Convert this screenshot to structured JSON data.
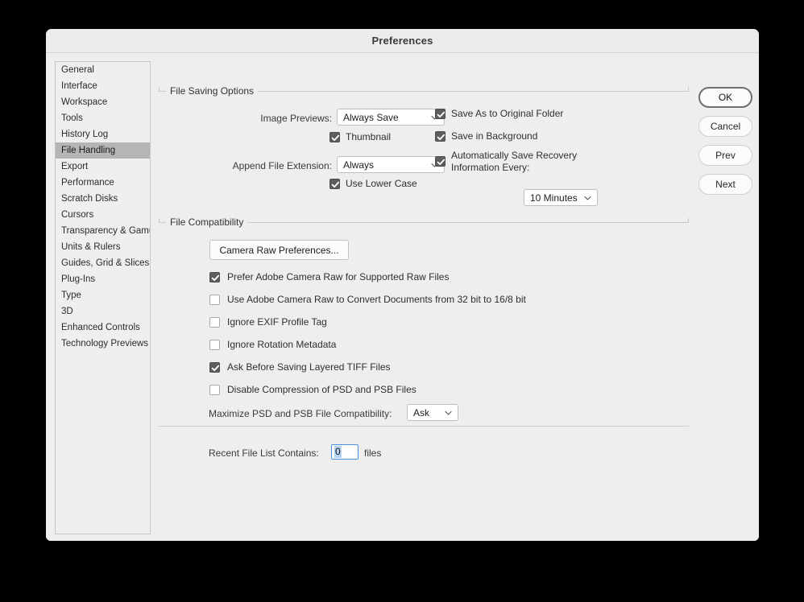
{
  "window": {
    "title": "Preferences"
  },
  "sidebar": {
    "items": [
      {
        "label": "General",
        "selected": false
      },
      {
        "label": "Interface",
        "selected": false
      },
      {
        "label": "Workspace",
        "selected": false
      },
      {
        "label": "Tools",
        "selected": false
      },
      {
        "label": "History Log",
        "selected": false
      },
      {
        "label": "File Handling",
        "selected": true
      },
      {
        "label": "Export",
        "selected": false
      },
      {
        "label": "Performance",
        "selected": false
      },
      {
        "label": "Scratch Disks",
        "selected": false
      },
      {
        "label": "Cursors",
        "selected": false
      },
      {
        "label": "Transparency & Gamut",
        "selected": false
      },
      {
        "label": "Units & Rulers",
        "selected": false
      },
      {
        "label": "Guides, Grid & Slices",
        "selected": false
      },
      {
        "label": "Plug-Ins",
        "selected": false
      },
      {
        "label": "Type",
        "selected": false
      },
      {
        "label": "3D",
        "selected": false
      },
      {
        "label": "Enhanced Controls",
        "selected": false
      },
      {
        "label": "Technology Previews",
        "selected": false
      }
    ]
  },
  "file_saving_options": {
    "legend": "File Saving Options",
    "image_previews_label": "Image Previews:",
    "image_previews_value": "Always Save",
    "thumbnail_label": "Thumbnail",
    "thumbnail_checked": true,
    "append_file_extension_label": "Append File Extension:",
    "append_file_extension_value": "Always",
    "use_lower_case_label": "Use Lower Case",
    "use_lower_case_checked": true,
    "save_as_original_folder_label": "Save As to Original Folder",
    "save_as_original_folder_checked": true,
    "save_in_background_label": "Save in Background",
    "save_in_background_checked": true,
    "auto_save_recovery_label": "Automatically Save Recovery Information Every:",
    "auto_save_recovery_checked": true,
    "auto_save_interval_value": "10 Minutes"
  },
  "file_compatibility": {
    "legend": "File Compatibility",
    "camera_raw_button_label": "Camera Raw Preferences...",
    "checkboxes": [
      {
        "label": "Prefer Adobe Camera Raw for Supported Raw Files",
        "checked": true
      },
      {
        "label": "Use Adobe Camera Raw to Convert Documents from 32 bit to 16/8 bit",
        "checked": false
      },
      {
        "label": "Ignore EXIF Profile Tag",
        "checked": false
      },
      {
        "label": "Ignore Rotation Metadata",
        "checked": false
      },
      {
        "label": "Ask Before Saving Layered TIFF Files",
        "checked": true
      },
      {
        "label": "Disable Compression of PSD and PSB Files",
        "checked": false
      }
    ],
    "maximize_label": "Maximize PSD and PSB File Compatibility:",
    "maximize_value": "Ask"
  },
  "recent_files": {
    "label": "Recent File List Contains:",
    "value": "0",
    "suffix": "files"
  },
  "buttons": {
    "ok": "OK",
    "cancel": "Cancel",
    "prev": "Prev",
    "next": "Next"
  },
  "colors": {
    "dialog_bg": "#eeeeee",
    "titlebar_bg": "#ececec",
    "selection_gray": "#b5b5b5",
    "checkbox_on": "#5d5d5d",
    "focus_blue": "#4a90e2",
    "text_selection_blue": "#b6d3f4"
  }
}
